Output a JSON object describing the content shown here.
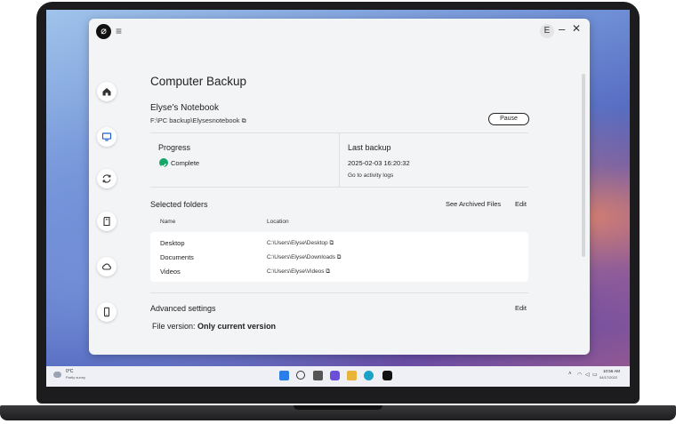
{
  "app": {
    "user_initial": "E"
  },
  "page": {
    "title": "Computer Backup"
  },
  "device": {
    "name": "Elyse's Notebook",
    "path": "F:\\PC backup\\Elysesnotebook",
    "pause_label": "Pause"
  },
  "progress": {
    "label": "Progress",
    "status": "Complete",
    "status_color": "#15a66a"
  },
  "last_backup": {
    "label": "Last backup",
    "datetime": "2025-02-03 16:20:32",
    "link": "Go to activity logs"
  },
  "selected_folders": {
    "heading": "Selected folders",
    "archived_link": "See Archived Files",
    "edit_label": "Edit",
    "col_name": "Name",
    "col_location": "Location",
    "rows": [
      {
        "name": "Desktop",
        "location": "C:\\Users\\Elyse\\Desktop"
      },
      {
        "name": "Documents",
        "location": "C:\\Users\\Elyse\\Downloads"
      },
      {
        "name": "Videos",
        "location": "C:\\Users\\Elyse\\Videos"
      }
    ]
  },
  "advanced": {
    "heading": "Advanced settings",
    "edit_label": "Edit",
    "file_version_label": "File version:",
    "file_version_value": "Only current version"
  },
  "nav": {
    "items": [
      "home-icon",
      "computer-icon",
      "sync-icon",
      "sd-card-icon",
      "cloud-icon",
      "phone-icon"
    ]
  },
  "taskbar": {
    "weather_temp": "0°C",
    "weather_desc": "Partly sunny",
    "time": "10:56 AM",
    "date": "04/17/2022"
  }
}
